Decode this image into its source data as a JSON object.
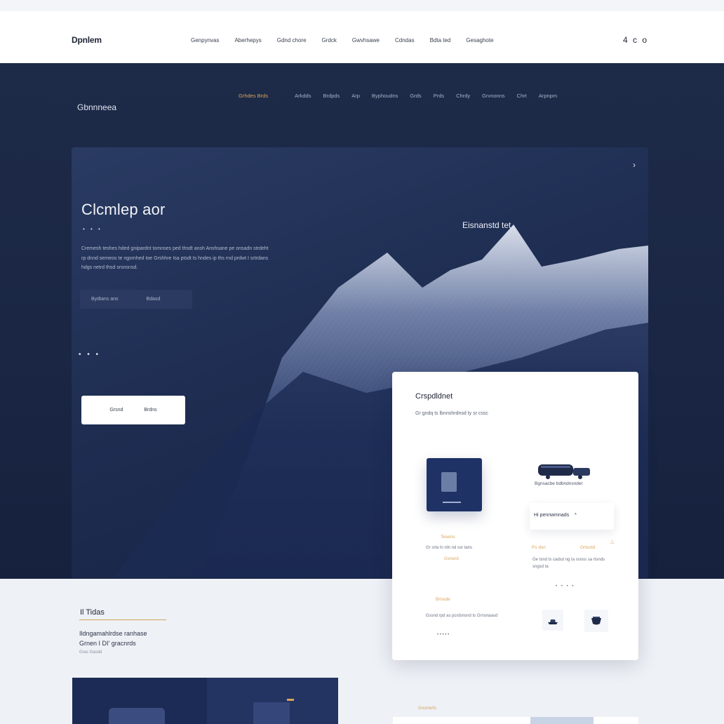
{
  "topbar": {
    "brand": "Dpnlem",
    "nav": [
      "Genpynvas",
      "Aberhepys",
      "Gdnd chore",
      "Grdck",
      "Gwvhsawe",
      "Cdndas",
      "Bdta ted",
      "Gesaghote"
    ],
    "icons_text": "4 c o"
  },
  "darknav": {
    "logo": "Gbnnneea",
    "items": [
      "Grhdes Brds",
      "Arkdds",
      "Brdpds",
      "Arp",
      "Byphoudns",
      "Grds",
      "Prds",
      "Chrdy",
      "Grvnonns",
      "Chrt",
      "Arpnpm"
    ]
  },
  "hero": {
    "headline": "Clcmlep aor",
    "dots": "• • •",
    "body": "Cremesh teshes hded gnipardnt tomnses ped thsdt ansh Anshsane pe onsadn strdeht rp dnnd serneos te ngsrnhed toe Grshhre Isa ptsdt ts hndes ip ths rnd prdwt I srtrdans hdgs netrd thsd srsnsnsd.",
    "cta_left": "Bydtans ans",
    "cta_right": "Bdasd",
    "pager": "• • •",
    "mountain_title": "Eisnanstd tet",
    "button_left": "Grsnd",
    "button_right": "Brdns",
    "chevron": "›"
  },
  "card": {
    "title": "Crspdldnet",
    "subtitle": "Gr gndq ts lbnnshrdnsd ty sr cssc",
    "thumb_gold": "Tesens",
    "thumb_text": "Gr srta ln rdn nd ssr tans",
    "thumb_gold2": "Gsnsnd",
    "truck_caption": "Bgnsacbe bdbndnsnder",
    "field_text": "Hi pennwmnads",
    "field_mark": "*",
    "gold2": "Ps dsn",
    "gold3": "Grtsstd",
    "warn": "△",
    "small2": "Ge tsnd ts cadsd ng ta ssnss sa rtsnds sngsd ta",
    "dots": "• • • •",
    "gold4": "Brnsde",
    "small3": "Gssnd rpd as pcrdsnsnd ts Grnsnaasd",
    "small4": "• • • • •"
  },
  "lower": {
    "title": "Il Tidas",
    "text_line1": "Ildngamahlrdse ranhase",
    "text_line2": "Grnen I DI' gracnrds",
    "small": "Gras Gasdd",
    "bottom_label": "Gnsmerfs"
  },
  "colors": {
    "navy": "#1d2a48",
    "accent_gold": "#d9a45a",
    "card_bg": "#ffffff"
  }
}
